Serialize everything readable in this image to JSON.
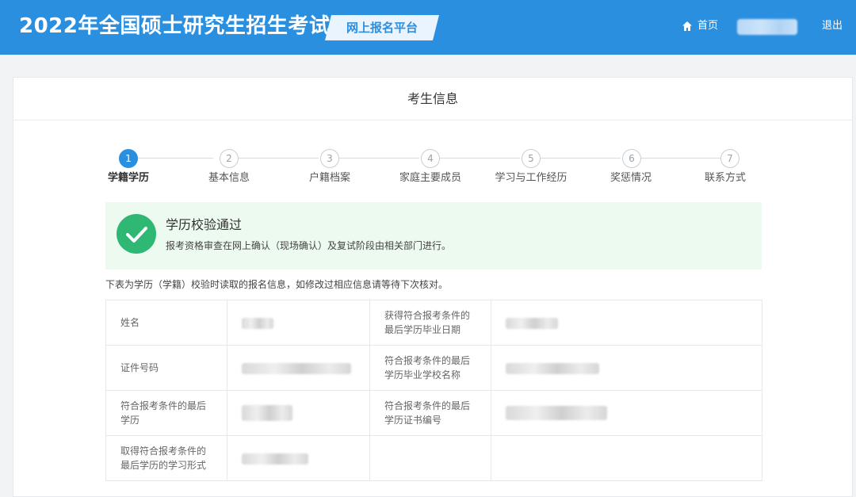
{
  "header": {
    "site_title": "2022年全国硕士研究生招生考试",
    "platform_label": "网上报名平台",
    "home_label": "首页",
    "logout_label": "退出",
    "brand_color": "#2b8fe0"
  },
  "panel": {
    "title": "考生信息"
  },
  "steps": [
    {
      "number": "1",
      "label": "学籍学历",
      "active": true
    },
    {
      "number": "2",
      "label": "基本信息",
      "active": false
    },
    {
      "number": "3",
      "label": "户籍档案",
      "active": false
    },
    {
      "number": "4",
      "label": "家庭主要成员",
      "active": false
    },
    {
      "number": "5",
      "label": "学习与工作经历",
      "active": false
    },
    {
      "number": "6",
      "label": "奖惩情况",
      "active": false
    },
    {
      "number": "7",
      "label": "联系方式",
      "active": false
    }
  ],
  "success": {
    "title": "学历校验通过",
    "description": "报考资格审查在网上确认（现场确认）及复试阶段由相关部门进行。",
    "icon": "check-circle-icon",
    "color": "#2eb873"
  },
  "note": "下表为学历（学籍）校验时读取的报名信息，如修改过相应信息请等待下次核对。",
  "table": {
    "rows": [
      {
        "left_label": "姓名",
        "right_label": "获得符合报考条件的最后学历毕业日期"
      },
      {
        "left_label": "证件号码",
        "right_label": "符合报考条件的最后学历毕业学校名称"
      },
      {
        "left_label": "符合报考条件的最后学历",
        "right_label": "符合报考条件的最后学历证书编号"
      },
      {
        "left_label": "取得符合报考条件的最后学历的学习形式",
        "right_label": ""
      }
    ]
  }
}
